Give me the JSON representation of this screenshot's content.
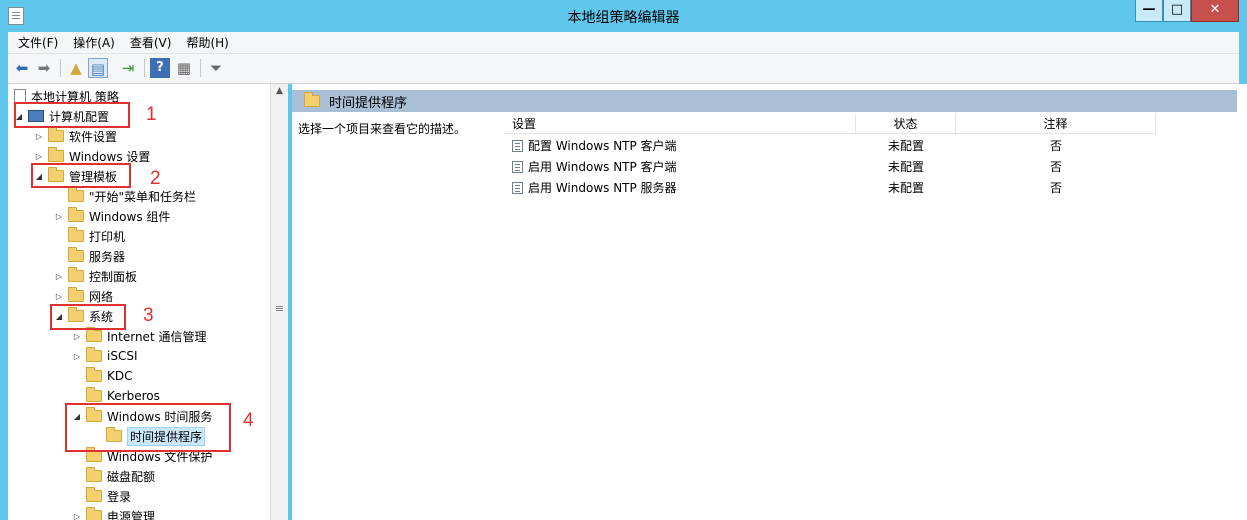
{
  "window": {
    "title": "本地组策略编辑器"
  },
  "menu": [
    "文件(F)",
    "操作(A)",
    "查看(V)",
    "帮助(H)"
  ],
  "tree": {
    "root": "本地计算机 策略",
    "items": [
      "计算机配置",
      "软件设置",
      "Windows 设置",
      "管理模板",
      "\"开始\"菜单和任务栏",
      "Windows 组件",
      "打印机",
      "服务器",
      "控制面板",
      "网络",
      "系统",
      "Internet 通信管理",
      "iSCSI",
      "KDC",
      "Kerberos",
      "Windows 时间服务",
      "时间提供程序",
      "Windows 文件保护",
      "磁盘配额",
      "登录",
      "电源管理"
    ]
  },
  "annotations": [
    "1",
    "2",
    "3",
    "4"
  ],
  "details": {
    "header": "时间提供程序",
    "description": "选择一个项目来查看它的描述。",
    "columns": [
      "设置",
      "状态",
      "注释"
    ],
    "rows": [
      {
        "setting": "配置 Windows NTP 客户端",
        "state": "未配置",
        "note": "否"
      },
      {
        "setting": "启用 Windows NTP 客户端",
        "state": "未配置",
        "note": "否"
      },
      {
        "setting": "启用 Windows NTP 服务器",
        "state": "未配置",
        "note": "否"
      }
    ]
  },
  "colors": {
    "title_bar": "#5fc6ec",
    "header_bar": "#a9bfd6",
    "annotation": "#e03030",
    "selection": "#cce8ff"
  }
}
